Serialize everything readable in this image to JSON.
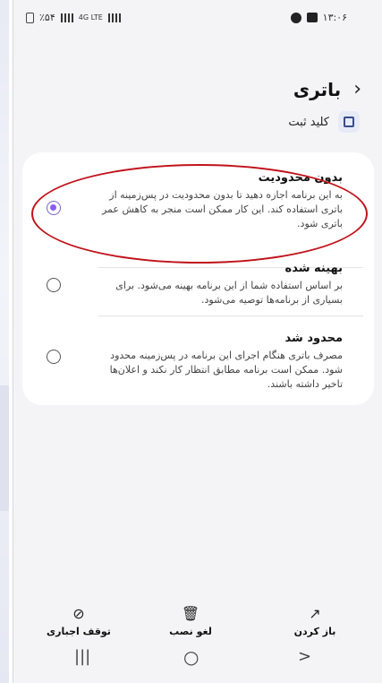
{
  "status_bar": {
    "left_text": "٪۵۴",
    "left_net": "4G LTE",
    "time": "۱۳:۰۶"
  },
  "header": {
    "back_icon": "‹",
    "title": "باتری"
  },
  "app": {
    "name": "کلید ثبت"
  },
  "options": [
    {
      "title": "بدون محدودیت",
      "desc": "به این برنامه اجازه دهید تا بدون محدودیت در پس‌زمینه از باتری استفاده کند. این کار ممکن است منجر به کاهش عمر باتری شود.",
      "selected": true
    },
    {
      "title": "بهینه شده",
      "desc": "بر اساس استفاده شما از این برنامه بهینه می‌شود. برای بسیاری از برنامه‌ها توصیه می‌شود.",
      "selected": false
    },
    {
      "title": "محدود شد",
      "desc": "مصرف باتری هنگام اجرای این برنامه در پس‌زمینه محدود شود. ممکن است برنامه مطابق انتظار کار نکند و اعلان‌ها تاخیر داشته باشند.",
      "selected": false
    }
  ],
  "actions": {
    "open": {
      "label": "باز کردن",
      "icon": "open-external-icon"
    },
    "uninstall": {
      "label": "لغو نصب",
      "icon": "trash-icon"
    },
    "force_stop": {
      "label": "توقف اجباری",
      "icon": "stop-icon"
    }
  },
  "colors": {
    "accent": "#8b5cf6",
    "highlight": "#c0121a",
    "background": "#f4f4f6",
    "card": "#ffffff"
  }
}
